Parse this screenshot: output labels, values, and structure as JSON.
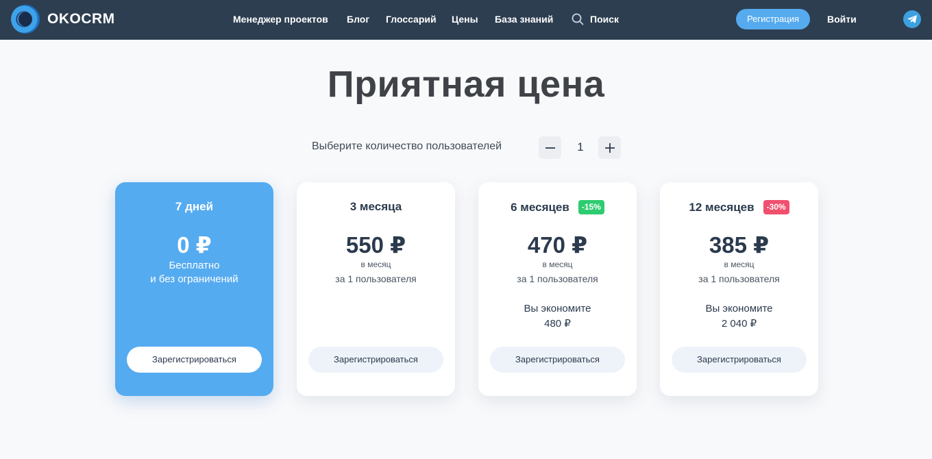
{
  "header": {
    "logo_text": "OKOCRM",
    "nav": [
      "Менеджер проектов",
      "Блог",
      "Глоссарий",
      "Цены",
      "База знаний"
    ],
    "search_label": "Поиск",
    "signup_label": "Регистрация",
    "login_label": "Войти",
    "icons": [
      "search-icon",
      "telegram-icon"
    ]
  },
  "main": {
    "title": "Приятная цена",
    "users_label": "Выберите количество пользователей",
    "users_count": "1",
    "minus_icon": "minus-icon",
    "plus_icon": "plus-icon"
  },
  "plans": [
    {
      "period": "7 дней",
      "price": "0 ₽",
      "sub1": "Бесплатно",
      "sub2": "и без ограничений",
      "button": "Зарегистрироваться"
    },
    {
      "period": "3 месяца",
      "price": "550 ₽",
      "sub1": "в месяц",
      "sub2": "за 1 пользователя",
      "button": "Зарегистрироваться"
    },
    {
      "period": "6 месяцев",
      "badge": "-15%",
      "price": "470 ₽",
      "sub1": "в месяц",
      "sub2": "за 1 пользователя",
      "save_label": "Вы экономите",
      "save_amount": "480 ₽",
      "button": "Зарегистрироваться"
    },
    {
      "period": "12 месяцев",
      "badge": "-30%",
      "price": "385 ₽",
      "sub1": "в месяц",
      "sub2": "за 1 пользователя",
      "save_label": "Вы экономите",
      "save_amount": "2 040 ₽",
      "button": "Зарегистрироваться"
    }
  ],
  "colors": {
    "header_bg": "#2d3e50",
    "accent": "#55abf0",
    "badge_green": "#2ecc71",
    "badge_red": "#f0506e",
    "page_bg": "#f8f9fb"
  }
}
